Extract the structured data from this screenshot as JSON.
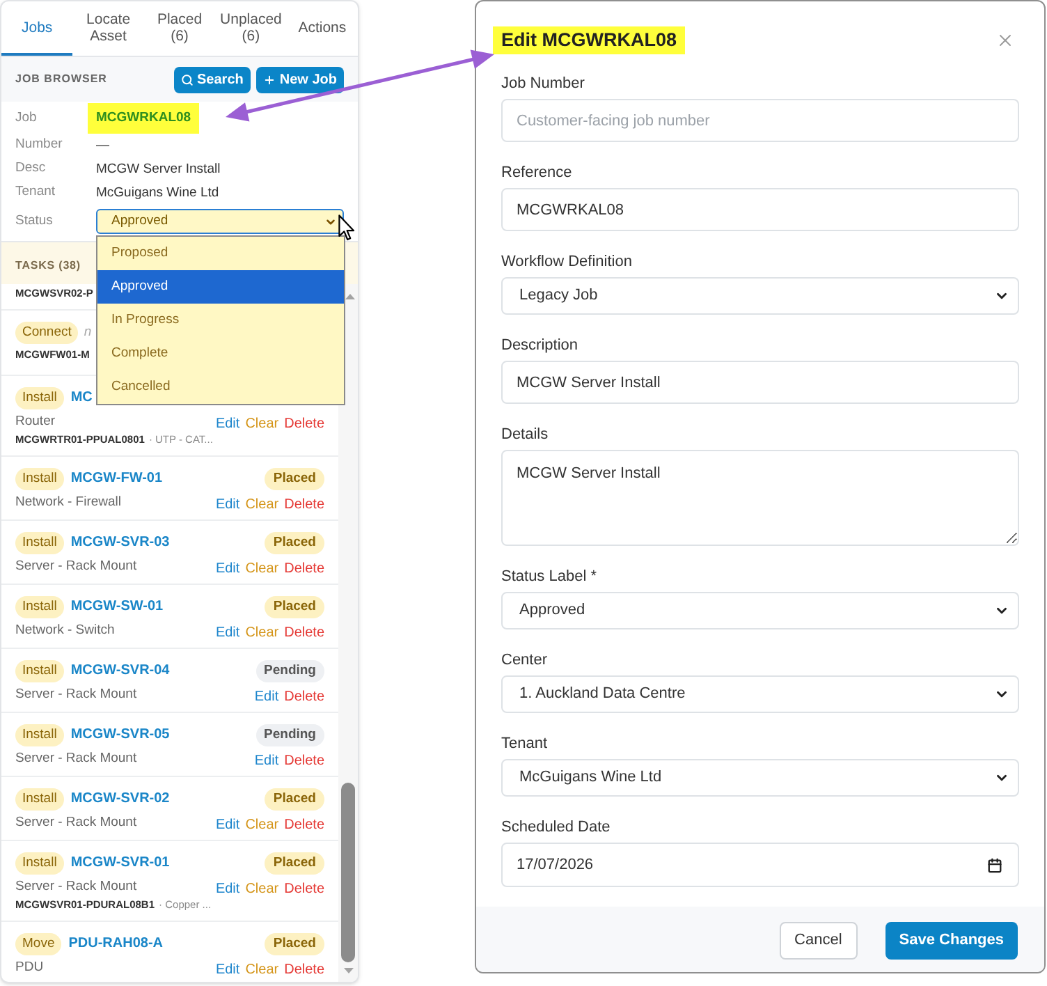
{
  "job_panel": {
    "tabs": [
      {
        "label": "Jobs",
        "selected": true
      },
      {
        "label": "Locate Asset",
        "selected": false
      },
      {
        "label": "Placed (6)",
        "selected": false
      },
      {
        "label": "Unplaced (6)",
        "selected": false
      },
      {
        "label": "Actions",
        "selected": false
      }
    ],
    "browser": {
      "title": "JOB BROWSER",
      "buttons": [
        {
          "label": "Search",
          "kind": "search"
        },
        {
          "label": "New Job",
          "kind": "add"
        }
      ]
    },
    "details": [
      {
        "label": "Job",
        "value": "MCGWRKAL08",
        "kind": "id",
        "highlighted": true
      },
      {
        "label": "Number",
        "value": "—",
        "kind": "text",
        "highlighted": false
      },
      {
        "label": "Desc",
        "value": "MCGW Server Install",
        "kind": "text",
        "highlighted": false
      },
      {
        "label": "Tenant",
        "value": "McGuigans Wine Ltd",
        "kind": "text",
        "highlighted": false
      }
    ],
    "status": {
      "label": "Status",
      "value": "Approved",
      "expanded": true,
      "options": [
        {
          "label": "Proposed",
          "selected": false
        },
        {
          "label": "Approved",
          "selected": true
        },
        {
          "label": "In Progress",
          "selected": false
        },
        {
          "label": "Complete",
          "selected": false
        },
        {
          "label": "Cancelled",
          "selected": false
        }
      ]
    },
    "tasks": {
      "title": "TASKS (38)",
      "rows": [
        {
          "code": "MCGWSVR02-P"
        },
        {
          "action": "Connect",
          "note": "n",
          "code": "MCGWFW01-M"
        },
        {
          "action": "Install",
          "name": "MC",
          "type": "Router",
          "code": "MCGWRTR01-PPUAL0801",
          "detail": "· UTP - CAT...",
          "links": [
            {
              "label": "Edit",
              "kind": "edit"
            },
            {
              "label": "Clear",
              "kind": "clear"
            },
            {
              "label": "Delete",
              "kind": "delete"
            }
          ]
        },
        {
          "action": "Install",
          "name": "MCGW-FW-01",
          "status": {
            "label": "Placed",
            "kind": "placed"
          },
          "type": "Network - Firewall",
          "links": [
            {
              "label": "Edit",
              "kind": "edit"
            },
            {
              "label": "Clear",
              "kind": "clear"
            },
            {
              "label": "Delete",
              "kind": "delete"
            }
          ]
        },
        {
          "action": "Install",
          "name": "MCGW-SVR-03",
          "status": {
            "label": "Placed",
            "kind": "placed"
          },
          "type": "Server - Rack Mount",
          "links": [
            {
              "label": "Edit",
              "kind": "edit"
            },
            {
              "label": "Clear",
              "kind": "clear"
            },
            {
              "label": "Delete",
              "kind": "delete"
            }
          ]
        },
        {
          "action": "Install",
          "name": "MCGW-SW-01",
          "status": {
            "label": "Placed",
            "kind": "placed"
          },
          "type": "Network - Switch",
          "links": [
            {
              "label": "Edit",
              "kind": "edit"
            },
            {
              "label": "Clear",
              "kind": "clear"
            },
            {
              "label": "Delete",
              "kind": "delete"
            }
          ]
        },
        {
          "action": "Install",
          "name": "MCGW-SVR-04",
          "status": {
            "label": "Pending",
            "kind": "pending"
          },
          "type": "Server - Rack Mount",
          "links": [
            {
              "label": "Edit",
              "kind": "edit"
            },
            {
              "label": "Delete",
              "kind": "delete"
            }
          ]
        },
        {
          "action": "Install",
          "name": "MCGW-SVR-05",
          "status": {
            "label": "Pending",
            "kind": "pending"
          },
          "type": "Server - Rack Mount",
          "links": [
            {
              "label": "Edit",
              "kind": "edit"
            },
            {
              "label": "Delete",
              "kind": "delete"
            }
          ]
        },
        {
          "action": "Install",
          "name": "MCGW-SVR-02",
          "status": {
            "label": "Placed",
            "kind": "placed"
          },
          "type": "Server - Rack Mount",
          "links": [
            {
              "label": "Edit",
              "kind": "edit"
            },
            {
              "label": "Clear",
              "kind": "clear"
            },
            {
              "label": "Delete",
              "kind": "delete"
            }
          ]
        },
        {
          "action": "Install",
          "name": "MCGW-SVR-01",
          "status": {
            "label": "Placed",
            "kind": "placed"
          },
          "type": "Server - Rack Mount",
          "code": "MCGWSVR01-PDURAL08B1",
          "detail": "· Copper ...",
          "links": [
            {
              "label": "Edit",
              "kind": "edit"
            },
            {
              "label": "Clear",
              "kind": "clear"
            },
            {
              "label": "Delete",
              "kind": "delete"
            }
          ]
        },
        {
          "action": "Move",
          "name": "PDU-RAH08-A",
          "status": {
            "label": "Placed",
            "kind": "placed"
          },
          "type": "PDU",
          "links": [
            {
              "label": "Edit",
              "kind": "edit"
            },
            {
              "label": "Clear",
              "kind": "clear"
            },
            {
              "label": "Delete",
              "kind": "delete"
            }
          ]
        }
      ]
    }
  },
  "edit_dialog": {
    "title": "Edit MCGWRKAL08",
    "highlighted": true,
    "fields": [
      {
        "label": "Job Number",
        "kind": "text",
        "placeholder": "Customer-facing job number"
      },
      {
        "label": "Reference",
        "kind": "text",
        "value": "MCGWRKAL08"
      },
      {
        "label": "Workflow Definition",
        "kind": "select",
        "value": "Legacy Job"
      },
      {
        "label": "Description",
        "kind": "text",
        "value": "MCGW Server Install"
      },
      {
        "label": "Details",
        "kind": "textarea",
        "value": "MCGW Server Install"
      },
      {
        "label": "Status Label *",
        "kind": "select",
        "value": "Approved"
      },
      {
        "label": "Center",
        "kind": "select",
        "value": "1. Auckland Data Centre"
      },
      {
        "label": "Tenant",
        "kind": "select",
        "value": "McGuigans Wine Ltd"
      },
      {
        "label": "Scheduled Date",
        "kind": "date",
        "value": "17/07/2026"
      }
    ],
    "buttons": [
      {
        "label": "Cancel",
        "kind": "secondary"
      },
      {
        "label": "Save Changes",
        "kind": "primary"
      }
    ]
  }
}
